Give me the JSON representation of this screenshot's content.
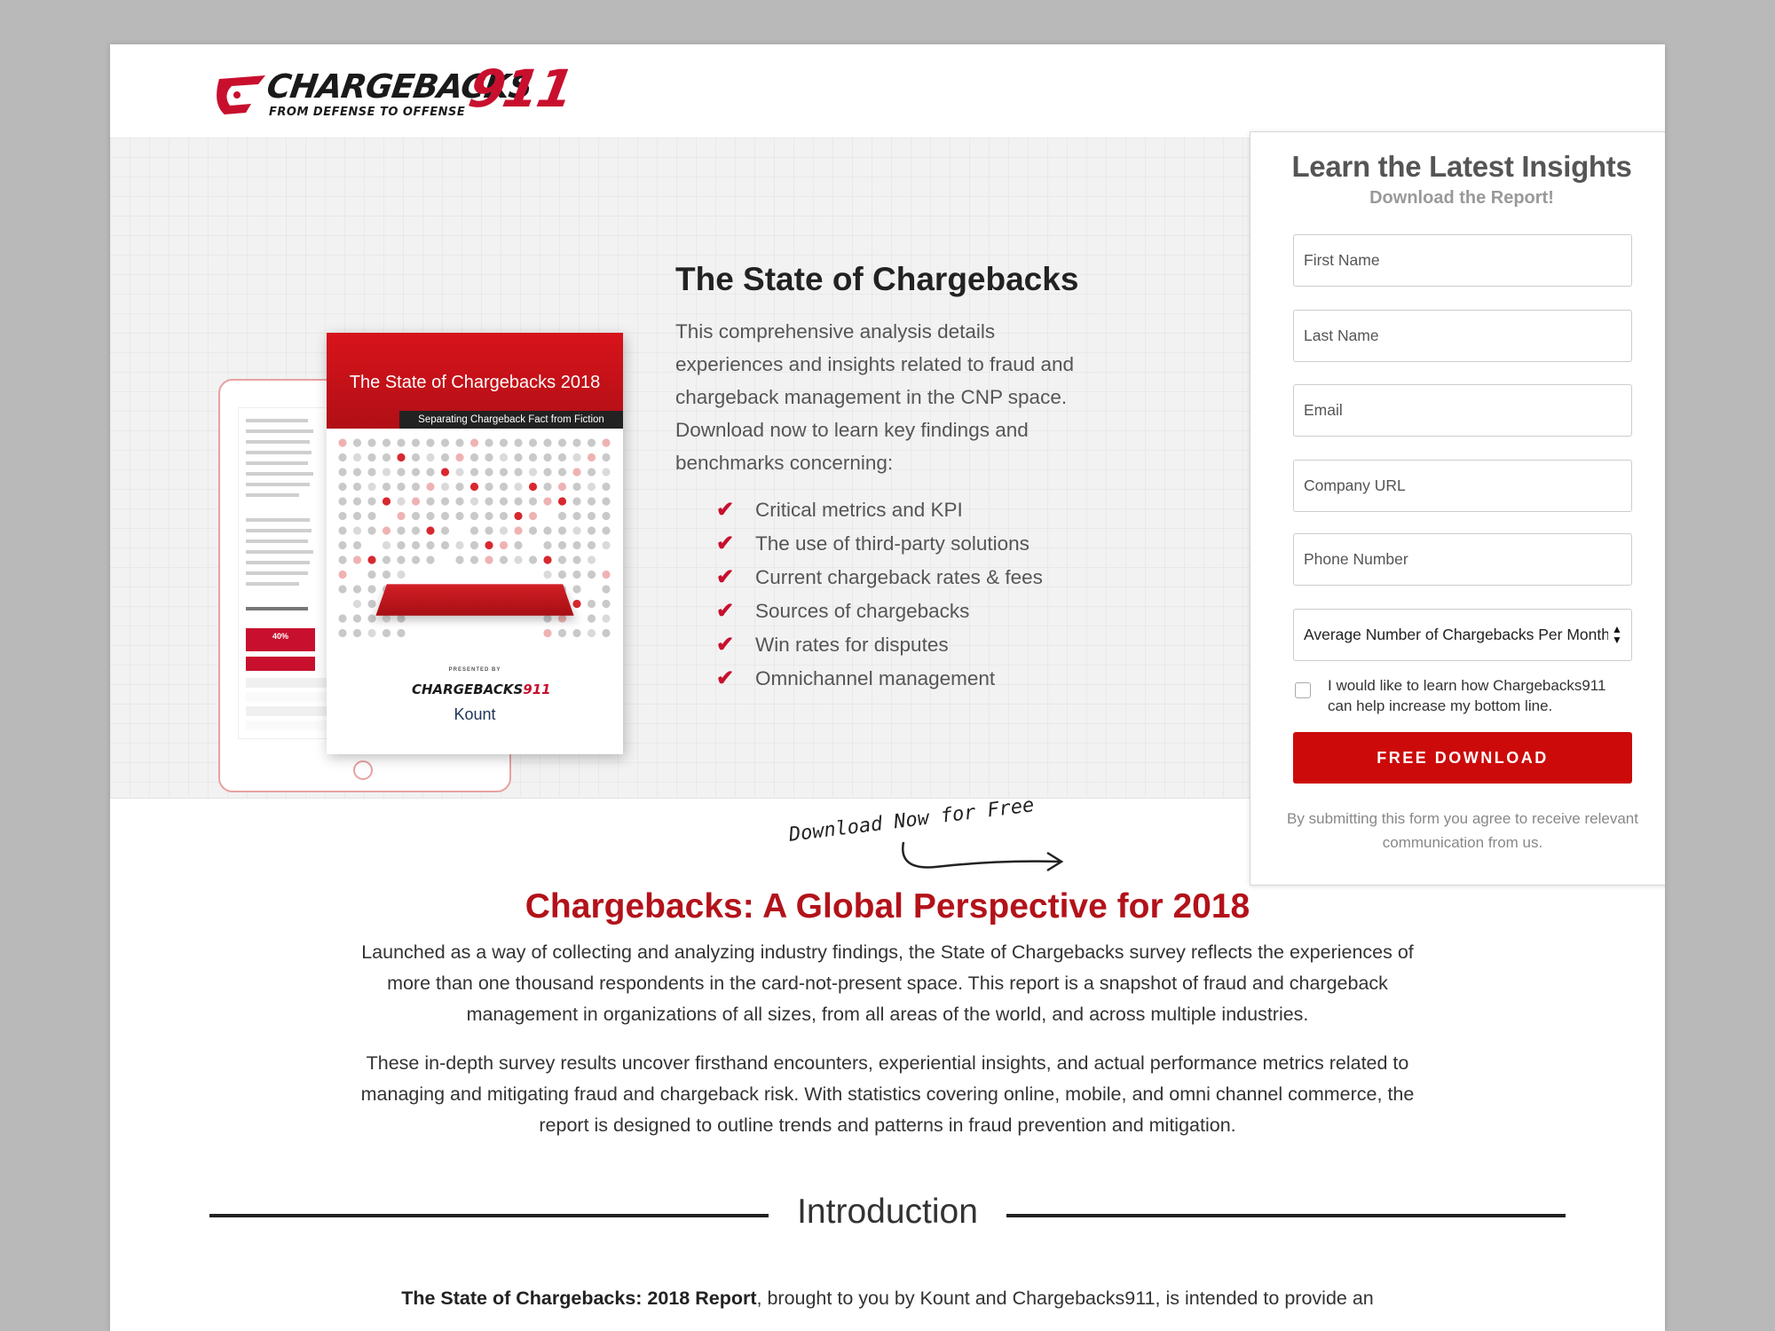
{
  "brand": {
    "logo_word": "CHARGEBACKS",
    "logo_number": "911",
    "logo_tagline": "FROM DEFENSE TO OFFENSE",
    "accent_color": "#c8102e"
  },
  "hero": {
    "headline": "The State of Chargebacks",
    "intro": "This comprehensive analysis details experiences and insights related to fraud and chargeback management in the CNP space. Download now to learn key findings and benchmarks concerning:",
    "checklist": [
      "Critical metrics and KPI",
      "The use of third-party solutions",
      "Current chargeback rates & fees",
      "Sources of chargebacks",
      "Win rates for disputes",
      "Omnichannel management"
    ],
    "download_note": "Download Now for Free",
    "report_cover": {
      "title": "The State of Chargebacks 2018",
      "subtitle": "Separating Chargeback Fact from Fiction",
      "presented_by": "PRESENTED BY",
      "partner": "Kount",
      "table_highlight": "40%"
    }
  },
  "form": {
    "title": "Learn the Latest Insights",
    "subtitle": "Download the Report!",
    "fields": {
      "first_name": "First Name",
      "last_name": "Last Name",
      "email": "Email",
      "company_url": "Company URL",
      "phone": "Phone Number"
    },
    "select_value": "Average Number of Chargebacks Per Month",
    "checkbox_label": "I would like to learn how Chargebacks911 can help increase my bottom line.",
    "submit_label": "FREE DOWNLOAD",
    "disclaimer": "By submitting this form you agree to receive relevant communication from us."
  },
  "global": {
    "title": "Chargebacks: A Global Perspective for 2018",
    "paragraph1": "Launched as a way of collecting and analyzing industry findings, the State of Chargebacks survey reflects the experiences of more than one thousand respondents in the card-not-present space. This report is a snapshot of fraud and chargeback management in organizations of all sizes, from all areas of the world, and across multiple industries.",
    "paragraph2": "These in-depth survey results uncover firsthand encounters, experiential insights, and actual performance metrics related to managing and mitigating fraud and chargeback risk. With statistics covering online, mobile, and omni channel commerce, the report is designed to outline trends and patterns in fraud prevention and mitigation."
  },
  "introduction": {
    "heading": "Introduction",
    "lead_bold": "The State of Chargebacks: 2018 Report",
    "lead_rest": ", brought to you by Kount and Chargebacks911, is intended to provide an"
  }
}
